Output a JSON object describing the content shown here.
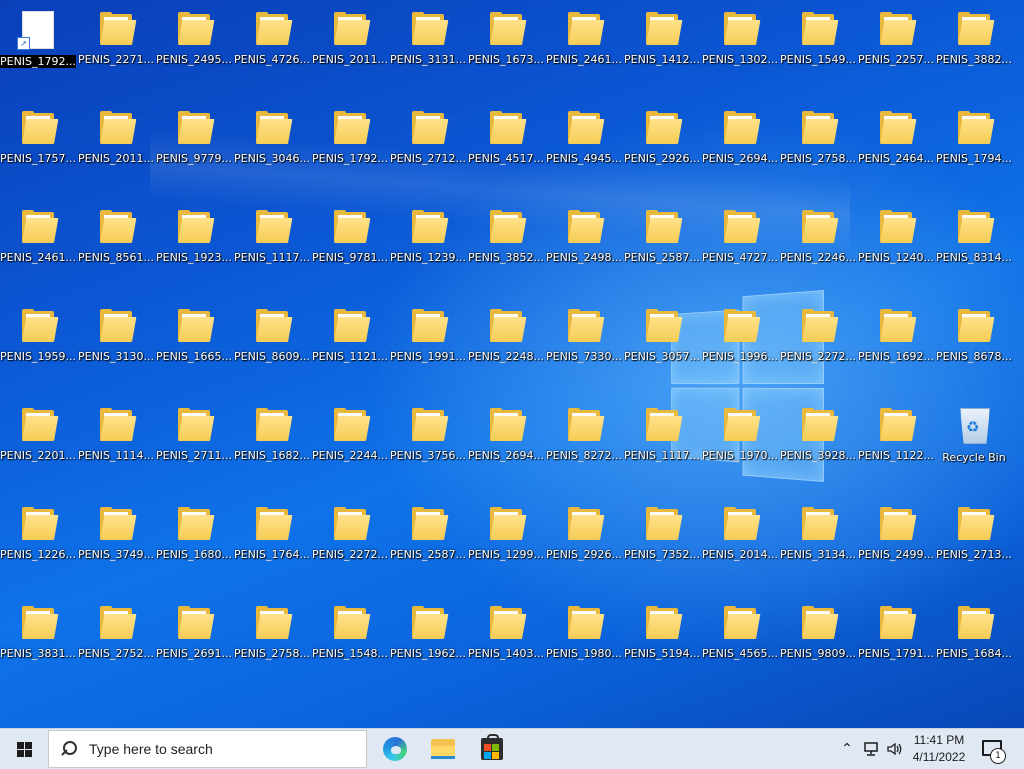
{
  "desktop": {
    "rows": [
      [
        "PENIS_1792...",
        "PENIS_2271...",
        "PENIS_2495...",
        "PENIS_4726...",
        "PENIS_2011...",
        "PENIS_3131...",
        "PENIS_1673...",
        "PENIS_2461...",
        "PENIS_1412...",
        "PENIS_1302...",
        "PENIS_1549...",
        "PENIS_2257...",
        "PENIS_3882..."
      ],
      [
        "PENIS_1757...",
        "PENIS_2011...",
        "PENIS_9779...",
        "PENIS_3046...",
        "PENIS_1792...",
        "PENIS_2712...",
        "PENIS_4517...",
        "PENIS_4945...",
        "PENIS_2926...",
        "PENIS_2694...",
        "PENIS_2758...",
        "PENIS_2464...",
        "PENIS_1794..."
      ],
      [
        "PENIS_2461...",
        "PENIS_8561...",
        "PENIS_1923...",
        "PENIS_1117...",
        "PENIS_9781...",
        "PENIS_1239...",
        "PENIS_3852...",
        "PENIS_2498...",
        "PENIS_2587...",
        "PENIS_4727...",
        "PENIS_2246...",
        "PENIS_1240...",
        "PENIS_8314..."
      ],
      [
        "PENIS_1959...",
        "PENIS_3130...",
        "PENIS_1665...",
        "PENIS_8609...",
        "PENIS_1121...",
        "PENIS_1991...",
        "PENIS_2248...",
        "PENIS_7330...",
        "PENIS_3057...",
        "PENIS_1996...",
        "PENIS_2272...",
        "PENIS_1692...",
        "PENIS_8678..."
      ],
      [
        "PENIS_2201...",
        "PENIS_1114...",
        "PENIS_2711...",
        "PENIS_1682...",
        "PENIS_2244...",
        "PENIS_3756...",
        "PENIS_2694...",
        "PENIS_8272...",
        "PENIS_1117...",
        "PENIS_1970...",
        "PENIS_3928...",
        "PENIS_1122...",
        "Recycle Bin"
      ],
      [
        "PENIS_1226...",
        "PENIS_3749...",
        "PENIS_1680...",
        "PENIS_1764...",
        "PENIS_2272...",
        "PENIS_2587...",
        "PENIS_1299...",
        "PENIS_2926...",
        "PENIS_7352...",
        "PENIS_2014...",
        "PENIS_3134...",
        "PENIS_2499...",
        "PENIS_2713..."
      ],
      [
        "PENIS_3831...",
        "PENIS_2752...",
        "PENIS_2691...",
        "PENIS_2758...",
        "PENIS_1548...",
        "PENIS_1962...",
        "PENIS_1403...",
        "PENIS_1980...",
        "PENIS_5194...",
        "PENIS_4565...",
        "PENIS_9809...",
        "PENIS_1791...",
        "PENIS_1684..."
      ]
    ],
    "selected_label": "PENIS_1792...",
    "recycle_bin_label": "Recycle Bin"
  },
  "taskbar": {
    "search_placeholder": "Type here to search",
    "pinned_icons": [
      "edge-icon",
      "file-explorer-icon",
      "store-icon"
    ],
    "time": "11:41 PM",
    "date": "4/11/2022",
    "notification_count": "1"
  }
}
